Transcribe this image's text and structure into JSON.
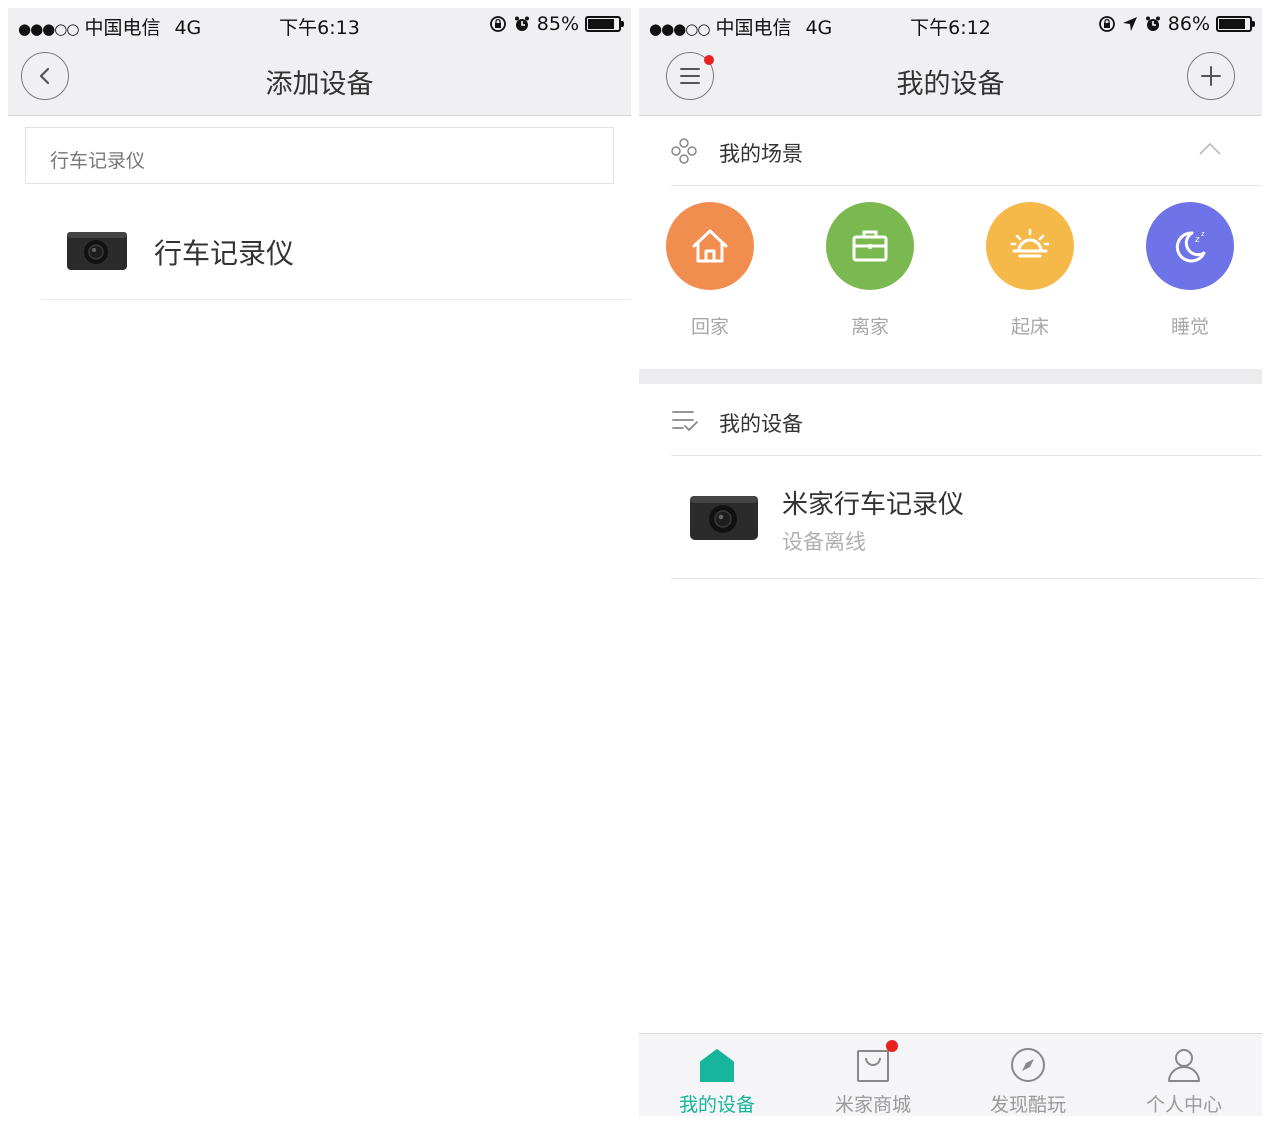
{
  "left": {
    "status": {
      "signal": "●●●○○",
      "carrier": "中国电信",
      "network": "4G",
      "time": "下午6:13",
      "battery": "85%",
      "battery_level": 0.85
    },
    "nav": {
      "title": "添加设备",
      "back_icon": "chevron-left-icon"
    },
    "search": {
      "value": "行车记录仪"
    },
    "results": [
      {
        "label": "行车记录仪",
        "icon": "dashcam-icon"
      }
    ]
  },
  "right": {
    "status": {
      "signal": "●●●○○",
      "carrier": "中国电信",
      "network": "4G",
      "time": "下午6:12",
      "battery": "86%",
      "battery_level": 0.86
    },
    "nav": {
      "title": "我的设备",
      "menu_icon": "hamburger-icon",
      "add_icon": "plus-icon"
    },
    "scenes": {
      "header": "我的场景",
      "items": [
        {
          "label": "回家",
          "icon": "home-icon",
          "color": "#f08d4f"
        },
        {
          "label": "离家",
          "icon": "briefcase-icon",
          "color": "#79b950"
        },
        {
          "label": "起床",
          "icon": "sunrise-icon",
          "color": "#f5b94a"
        },
        {
          "label": "睡觉",
          "icon": "moon-icon",
          "color": "#6e73e8"
        }
      ]
    },
    "devices": {
      "header": "我的设备",
      "items": [
        {
          "name": "米家行车记录仪",
          "status": "设备离线",
          "icon": "dashcam-icon"
        }
      ]
    },
    "tabs": [
      {
        "label": "我的设备",
        "icon": "home-tab-icon",
        "active": true
      },
      {
        "label": "米家商城",
        "icon": "shopping-bag-icon",
        "badge": true
      },
      {
        "label": "发现酷玩",
        "icon": "compass-icon"
      },
      {
        "label": "个人中心",
        "icon": "person-icon"
      }
    ],
    "accent": "#17b69c"
  }
}
